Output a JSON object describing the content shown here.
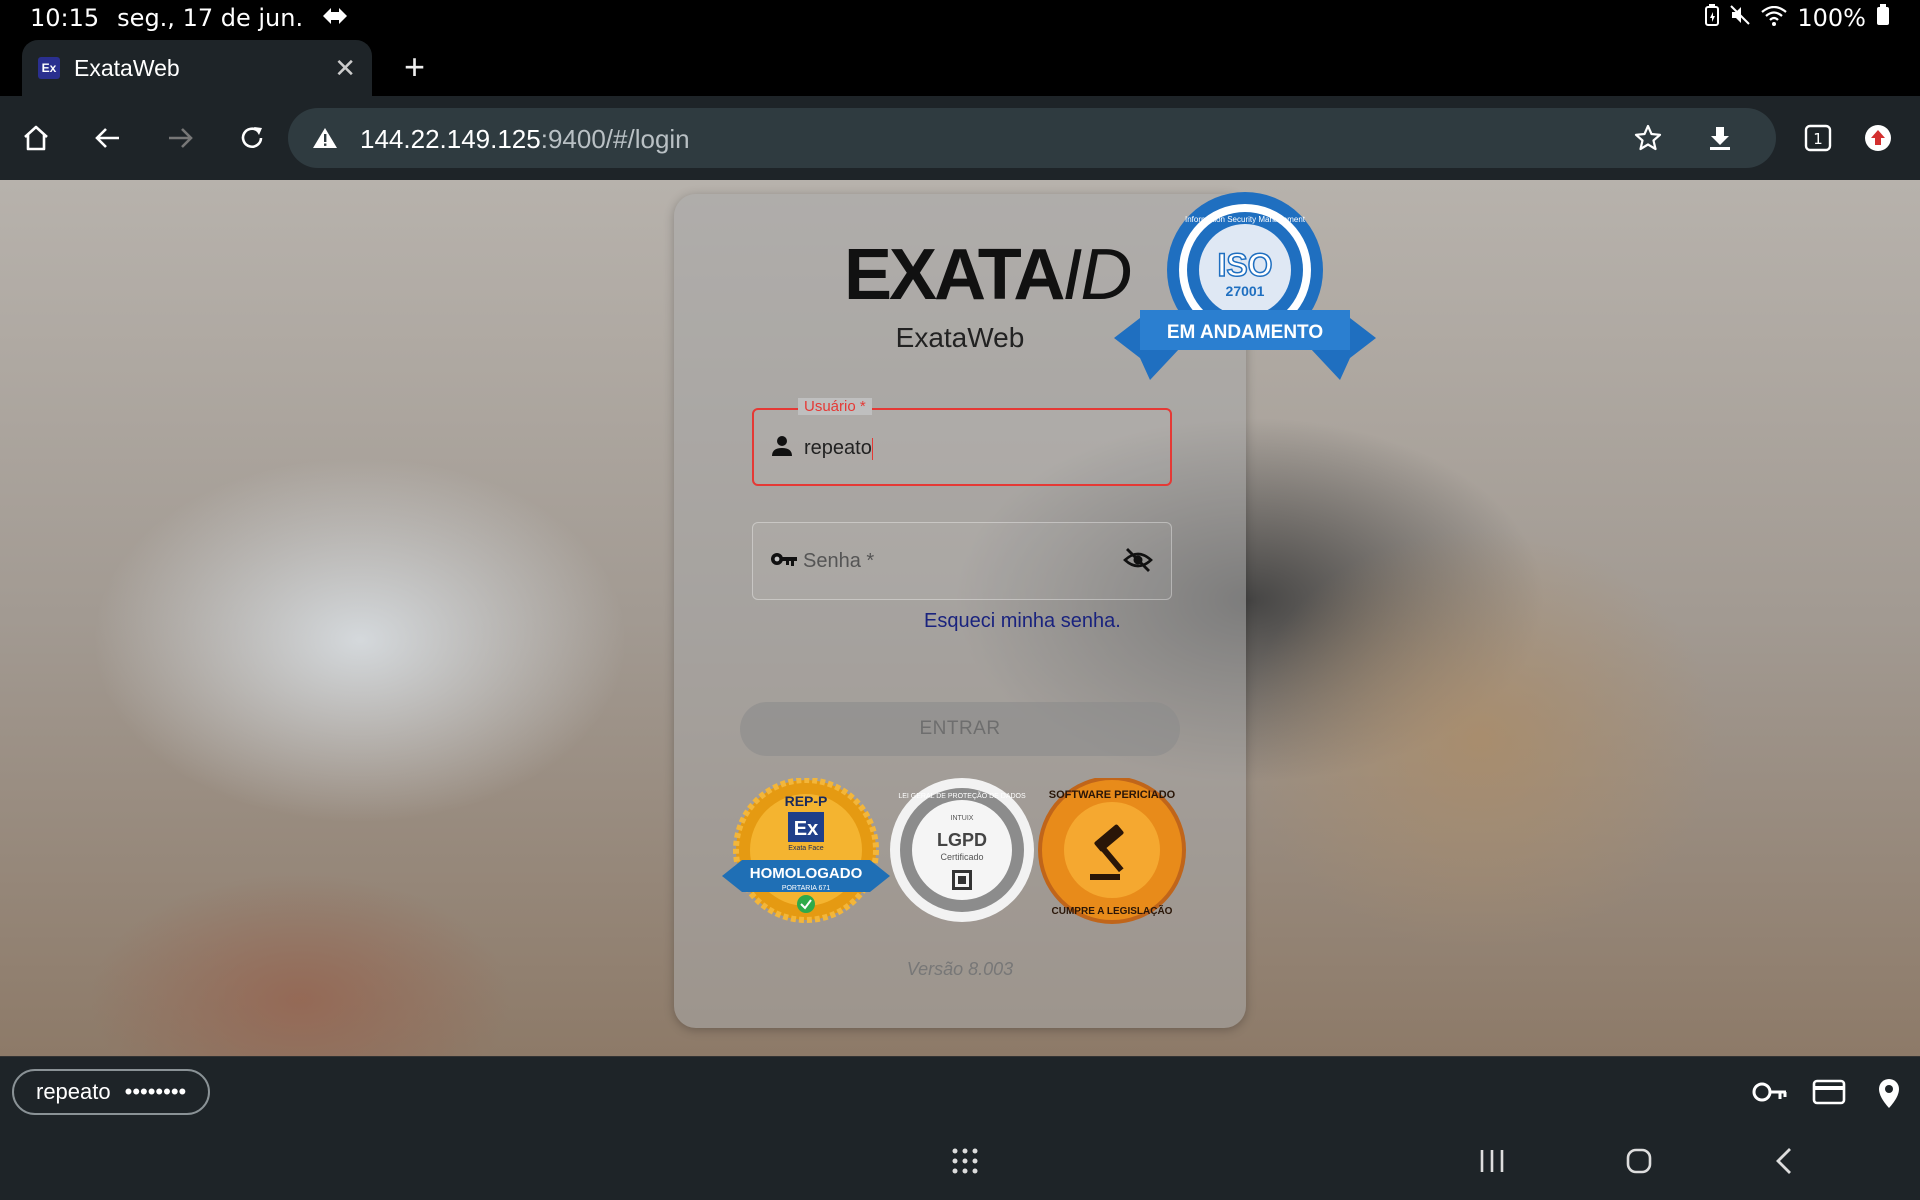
{
  "status": {
    "time": "10:15",
    "date": "seg., 17 de jun.",
    "battery": "100%"
  },
  "tab": {
    "favicon": "Ex",
    "title": "ExataWeb"
  },
  "omnibox": {
    "host": "144.22.149.125",
    "rest": ":9400/#/login",
    "tab_count": "1"
  },
  "login": {
    "app_name": "ExataWeb",
    "logo_main": "EXATA",
    "logo_suffix": "ID",
    "username_label": "Usuário *",
    "username_value": "repeato",
    "password_placeholder": "Senha *",
    "forgot_link": "Esqueci minha senha.",
    "submit_label": "ENTRAR",
    "version": "Versão 8.003"
  },
  "badges": {
    "rep": {
      "top": "REP-P",
      "mark": "Ex",
      "sub": "Exata Face",
      "main": "HOMOLOGADO",
      "foot": "PORTARIA 671"
    },
    "lgpd": {
      "ring": "LEI GERAL DE PROTEÇÃO DE DADOS",
      "brand": "INTUIX",
      "main": "LGPD",
      "sub": "Certificado"
    },
    "soft": {
      "top": "SOFTWARE PERICIADO",
      "bottom": "CUMPRE A LEGISLAÇÃO"
    },
    "iso": {
      "ring": "Information Security Management",
      "main": "ISO",
      "num": "27001",
      "ribbon": "EM ANDAMENTO"
    }
  },
  "autofill": {
    "username": "repeato",
    "password_mask": "••••••••"
  },
  "colors": {
    "error": "#e53935",
    "link": "#1a237e",
    "chrome_bg": "#1e2428"
  }
}
